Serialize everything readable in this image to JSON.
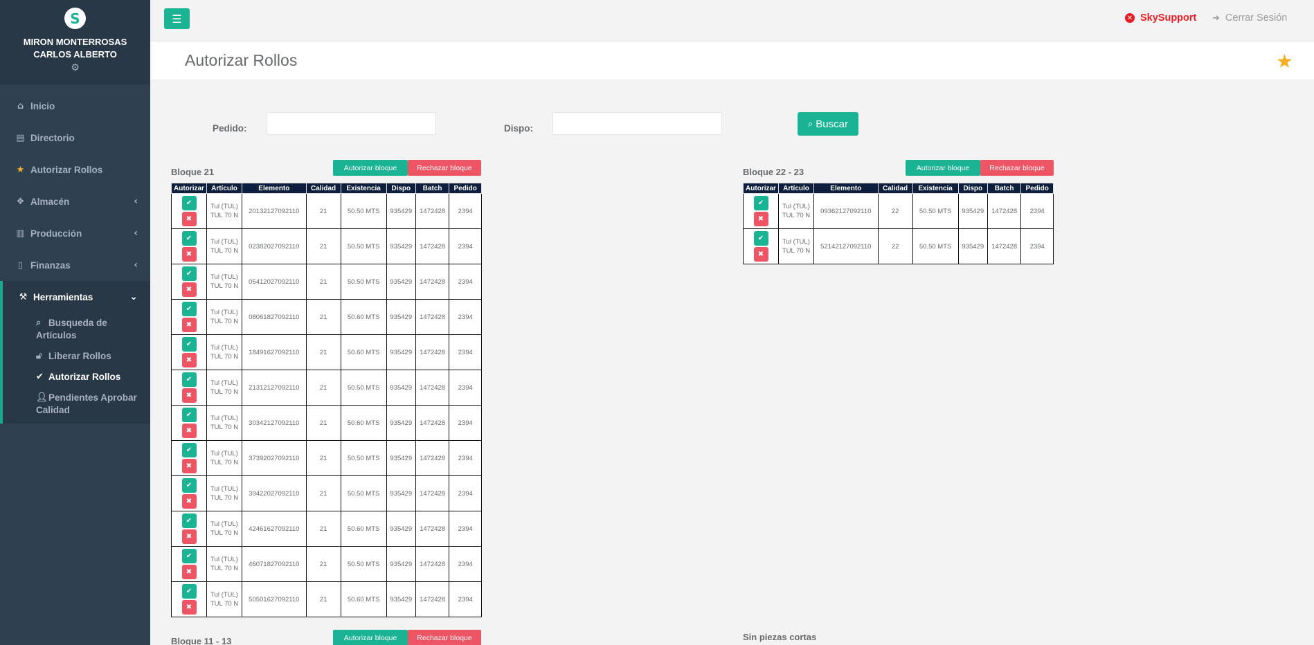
{
  "sidebar": {
    "user_line1": "MIRON MONTERROSAS",
    "user_line2": "CARLOS ALBERTO",
    "items": [
      {
        "label": "Inicio",
        "icon": "home-icon"
      },
      {
        "label": "Directorio",
        "icon": "address-book-icon"
      },
      {
        "label": "Autorizar Rollos",
        "icon": "star-icon"
      },
      {
        "label": "Almacén",
        "icon": "cubes-icon"
      },
      {
        "label": "Producción",
        "icon": "bar-chart-icon"
      },
      {
        "label": "Finanzas",
        "icon": "file-icon"
      },
      {
        "label": "Herramientas",
        "icon": "gavel-icon"
      }
    ],
    "subitems": [
      {
        "label": "Busqueda de Artículos",
        "icon": "search-icon"
      },
      {
        "label": "Liberar Rollos",
        "icon": "unlock-icon"
      },
      {
        "label": "Autorizar Rollos",
        "icon": "check-circle-icon"
      },
      {
        "label": "Pendientes Aprobar Calidad",
        "icon": "user-check-icon"
      }
    ]
  },
  "topbar": {
    "skysupport": "SkySupport",
    "logout": "Cerrar Sesión"
  },
  "page": {
    "title": "Autorizar Rollos"
  },
  "search": {
    "pedido_label": "Pedido:",
    "dispo_label": "Dispo:",
    "pedido_value": "",
    "dispo_value": "",
    "button": "Buscar"
  },
  "labels": {
    "authorize_block": "Autorizar bloque",
    "reject_block": "Rechazar bloque"
  },
  "columns": [
    "Autorizar",
    "Artículo",
    "Elemento",
    "Calidad",
    "Existencia",
    "Dispo",
    "Batch",
    "Pedido"
  ],
  "blocks": [
    {
      "title": "Bloque 21",
      "rows": [
        {
          "art1": "Tul (TUL)",
          "art2": "TUL 70 N",
          "elemento": "20132127092110",
          "calidad": "21",
          "existencia": "50.50 MTS",
          "dispo": "935429",
          "batch": "1472428",
          "pedido": "2394"
        },
        {
          "art1": "Tul (TUL)",
          "art2": "TUL 70 N",
          "elemento": "02382027092110",
          "calidad": "21",
          "existencia": "50.50 MTS",
          "dispo": "935429",
          "batch": "1472428",
          "pedido": "2394"
        },
        {
          "art1": "Tul (TUL)",
          "art2": "TUL 70 N",
          "elemento": "05412027092110",
          "calidad": "21",
          "existencia": "50.50 MTS",
          "dispo": "935429",
          "batch": "1472428",
          "pedido": "2394"
        },
        {
          "art1": "Tul (TUL)",
          "art2": "TUL 70 N",
          "elemento": "08061827092110",
          "calidad": "21",
          "existencia": "50.60 MTS",
          "dispo": "935429",
          "batch": "1472428",
          "pedido": "2394"
        },
        {
          "art1": "Tul (TUL)",
          "art2": "TUL 70 N",
          "elemento": "18491627092110",
          "calidad": "21",
          "existencia": "50.60 MTS",
          "dispo": "935429",
          "batch": "1472428",
          "pedido": "2394"
        },
        {
          "art1": "Tul (TUL)",
          "art2": "TUL 70 N",
          "elemento": "21312127092110",
          "calidad": "21",
          "existencia": "50.50 MTS",
          "dispo": "935429",
          "batch": "1472428",
          "pedido": "2394"
        },
        {
          "art1": "Tul (TUL)",
          "art2": "TUL 70 N",
          "elemento": "30342127092110",
          "calidad": "21",
          "existencia": "50.60 MTS",
          "dispo": "935429",
          "batch": "1472428",
          "pedido": "2394"
        },
        {
          "art1": "Tul (TUL)",
          "art2": "TUL 70 N",
          "elemento": "37392027092110",
          "calidad": "21",
          "existencia": "50.50 MTS",
          "dispo": "935429",
          "batch": "1472428",
          "pedido": "2394"
        },
        {
          "art1": "Tul (TUL)",
          "art2": "TUL 70 N",
          "elemento": "39422027092110",
          "calidad": "21",
          "existencia": "50.50 MTS",
          "dispo": "935429",
          "batch": "1472428",
          "pedido": "2394"
        },
        {
          "art1": "Tul (TUL)",
          "art2": "TUL 70 N",
          "elemento": "42461627092110",
          "calidad": "21",
          "existencia": "50.60 MTS",
          "dispo": "935429",
          "batch": "1472428",
          "pedido": "2394"
        },
        {
          "art1": "Tul (TUL)",
          "art2": "TUL 70 N",
          "elemento": "46071827092110",
          "calidad": "21",
          "existencia": "50.50 MTS",
          "dispo": "935429",
          "batch": "1472428",
          "pedido": "2394"
        },
        {
          "art1": "Tul (TUL)",
          "art2": "TUL 70 N",
          "elemento": "50501627092110",
          "calidad": "21",
          "existencia": "50.60 MTS",
          "dispo": "935429",
          "batch": "1472428",
          "pedido": "2394"
        }
      ]
    },
    {
      "title": "Bloque 22 - 23",
      "rows": [
        {
          "art1": "Tul (TUL)",
          "art2": "TUL 70 N",
          "elemento": "09362127092110",
          "calidad": "22",
          "existencia": "50.50 MTS",
          "dispo": "935429",
          "batch": "1472428",
          "pedido": "2394"
        },
        {
          "art1": "Tul (TUL)",
          "art2": "TUL 70 N",
          "elemento": "52142127092110",
          "calidad": "22",
          "existencia": "50.50 MTS",
          "dispo": "935429",
          "batch": "1472428",
          "pedido": "2394"
        }
      ]
    },
    {
      "title": "Bloque 11 - 13",
      "rows": []
    },
    {
      "title": "Sin piezas cortas",
      "rows": []
    }
  ],
  "colors": {
    "sidebar": "#2f4050",
    "primary": "#1ab394",
    "danger": "#ed5565",
    "header_dark": "#0d1f3c",
    "warning": "#f8ac26"
  }
}
